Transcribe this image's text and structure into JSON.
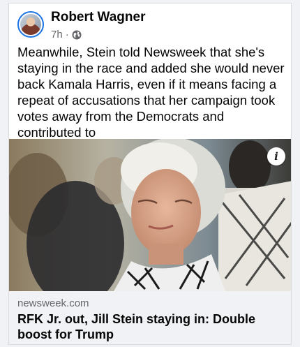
{
  "post": {
    "author": "Robert Wagner",
    "time": "7h",
    "separator": "·",
    "audience_icon": "globe-icon",
    "text": "Meanwhile, Stein told Newsweek that she's staying in the race and added she would never back Kamala Harris, even if it means facing a repeat of accusations that her campaign took votes away from the Democrats and contributed to"
  },
  "link_preview": {
    "domain": "newsweek.com",
    "title": "RFK Jr. out, Jill Stein staying in: Double boost for Trump",
    "info_icon": "info-icon",
    "info_label": "i"
  },
  "colors": {
    "accent": "#1b74e4",
    "text_primary": "#050505",
    "text_secondary": "#65676b",
    "link_bg": "#f0f2f5"
  }
}
